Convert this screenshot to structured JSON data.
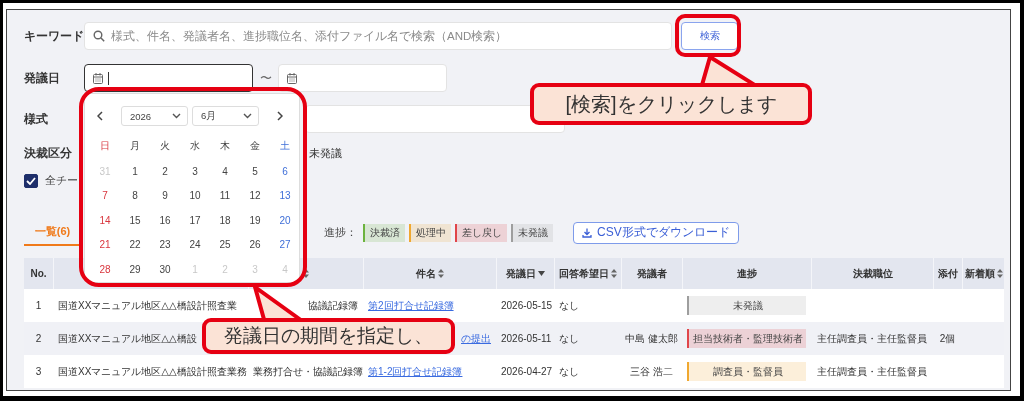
{
  "filters": {
    "keyword": {
      "label": "キーワード",
      "placeholder": "様式、件名、発議者名、進捗職位名、添付ファイル名で検索（AND検索）"
    },
    "search_button": "検索",
    "date": {
      "label": "発議日",
      "separator": "〜",
      "from": {
        "focused": true
      },
      "to": {
        "focused": false
      }
    },
    "form": {
      "label": "様式"
    },
    "decision": {
      "label": "決裁区分",
      "options": [
        "未発議"
      ]
    },
    "all_teams": {
      "label": "全チー",
      "checked": true
    }
  },
  "date_picker": {
    "year": "2026",
    "month": "6月",
    "weekdays": [
      "日",
      "月",
      "火",
      "水",
      "木",
      "金",
      "土"
    ],
    "weeks": [
      [
        {
          "day": "31",
          "muted": true
        },
        {
          "day": "1",
          "muted": false
        },
        {
          "day": "2",
          "muted": false
        },
        {
          "day": "3",
          "muted": false
        },
        {
          "day": "4",
          "muted": false
        },
        {
          "day": "5",
          "muted": false
        },
        {
          "day": "6",
          "muted": false
        }
      ],
      [
        {
          "day": "7",
          "muted": false
        },
        {
          "day": "8",
          "muted": false
        },
        {
          "day": "9",
          "muted": false
        },
        {
          "day": "10",
          "muted": false
        },
        {
          "day": "11",
          "muted": false
        },
        {
          "day": "12",
          "muted": false
        },
        {
          "day": "13",
          "muted": false
        }
      ],
      [
        {
          "day": "14",
          "muted": false
        },
        {
          "day": "15",
          "muted": false
        },
        {
          "day": "16",
          "muted": false
        },
        {
          "day": "17",
          "muted": false
        },
        {
          "day": "18",
          "muted": false
        },
        {
          "day": "19",
          "muted": false
        },
        {
          "day": "20",
          "muted": false
        }
      ],
      [
        {
          "day": "21",
          "muted": false
        },
        {
          "day": "22",
          "muted": false
        },
        {
          "day": "23",
          "muted": false
        },
        {
          "day": "24",
          "muted": false
        },
        {
          "day": "25",
          "muted": false
        },
        {
          "day": "26",
          "muted": false
        },
        {
          "day": "27",
          "muted": false
        }
      ],
      [
        {
          "day": "28",
          "muted": false
        },
        {
          "day": "29",
          "muted": false
        },
        {
          "day": "30",
          "muted": false
        },
        {
          "day": "1",
          "muted": true
        },
        {
          "day": "2",
          "muted": true
        },
        {
          "day": "3",
          "muted": true
        },
        {
          "day": "4",
          "muted": true
        }
      ]
    ]
  },
  "tabs": [
    {
      "label": "一覧(6)",
      "selected": true
    }
  ],
  "progress_legend": {
    "label": "進捗：",
    "items": [
      {
        "label": "決裁済",
        "color": "#6cb33e"
      },
      {
        "label": "処理中",
        "color": "#f0a830"
      },
      {
        "label": "差し戻し",
        "color": "#e0454a"
      },
      {
        "label": "未発議",
        "color": "#9e9e9e"
      }
    ]
  },
  "csv_button": "CSV形式でダウンロード",
  "table": {
    "columns": [
      {
        "label": "No.",
        "sortable": false,
        "sorted": false
      },
      {},
      {
        "sortable": true,
        "sorted": false
      },
      {
        "label": "件名",
        "sortable": true,
        "sorted": false
      },
      {
        "label": "発議日",
        "sortable": true,
        "sorted": true
      },
      {
        "label": "回答希望日",
        "sortable": true,
        "sorted": false
      },
      {
        "label": "発議者",
        "sortable": false,
        "sorted": false
      },
      {
        "label": "進捗",
        "sortable": false,
        "sorted": false
      },
      {
        "label": "決裁職位",
        "sortable": false,
        "sorted": false
      },
      {
        "label": "添付",
        "sortable": false,
        "sorted": false
      },
      {
        "label": "新着順",
        "sortable": true,
        "sorted": false
      }
    ],
    "rows": [
      {
        "no": "1",
        "project": "国道XXマニュアル地区△△橋設計照査業",
        "form": "協議記録簿",
        "form_cut": true,
        "title": "第2回打合せ記録簿",
        "title_cut": false,
        "date": "2026-05-15",
        "reply_by": "なし",
        "status": {
          "label": "未発議",
          "color": "#9e9e9e"
        }
      },
      {
        "no": "2",
        "project": "国道XXマニュアル地区△△橋設",
        "title": "の提出",
        "title_cut": true,
        "date": "2026-05-11",
        "reply_by": "なし",
        "author": "中島 健太郎",
        "status": {
          "label": "担当技術者・監理技術者",
          "color": "#e0454a"
        },
        "approver": "主任調査員・主任監督員",
        "attachments": "2個"
      },
      {
        "no": "3",
        "project": "国道XXマニュアル地区△△橋設計照査業務",
        "form": "業務打合せ・協議記録簿",
        "title": "第1-2回打合せ記録簿",
        "title_cut": false,
        "date": "2026-04-27",
        "reply_by": "なし",
        "author": "三谷 浩二",
        "status": {
          "label": "調査員・監督員",
          "color": "#f0a830"
        },
        "approver": "主任調査員・主任監督員"
      }
    ]
  },
  "callouts": [
    {
      "text": "[検索]をクリックします"
    },
    {
      "text": "発議日の期間を指定し、"
    }
  ]
}
